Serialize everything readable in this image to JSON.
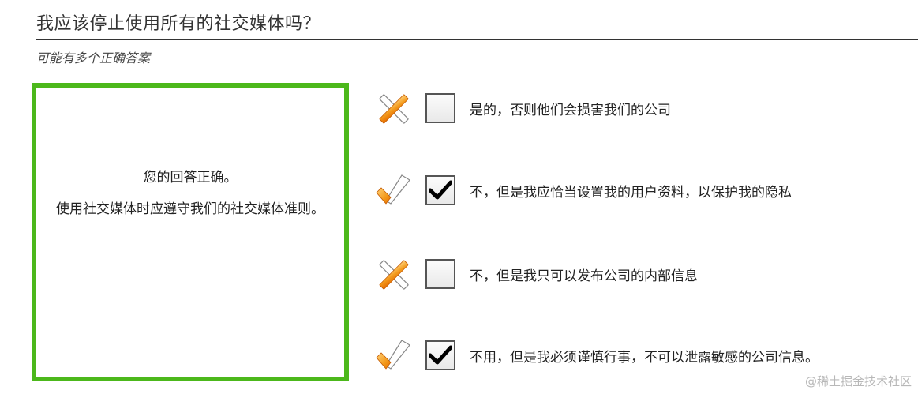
{
  "question": {
    "title": "我应该停止使用所有的社交媒体吗？",
    "hint": "可能有多个正确答案"
  },
  "feedback": {
    "line1": "您的回答正确。",
    "line2": "使用社交媒体时应遵守我们的社交媒体准则。"
  },
  "options": [
    {
      "label": "是的，否则他们会损害我们的公司",
      "checked": false,
      "mark": "cross-icon"
    },
    {
      "label": "不，但是我应恰当设置我的用户资料，以保护我的隐私",
      "checked": true,
      "mark": "check-icon"
    },
    {
      "label": "不，但是我只可以发布公司的内部信息",
      "checked": false,
      "mark": "cross-icon"
    },
    {
      "label": "不用，但是我必须谨慎行事，不可以泄露敏感的公司信息。",
      "checked": true,
      "mark": "check-icon"
    }
  ],
  "watermark": "@稀土掘金技术社区",
  "colors": {
    "correct_border": "#4cb81b",
    "mark_orange": "#f08a12"
  }
}
